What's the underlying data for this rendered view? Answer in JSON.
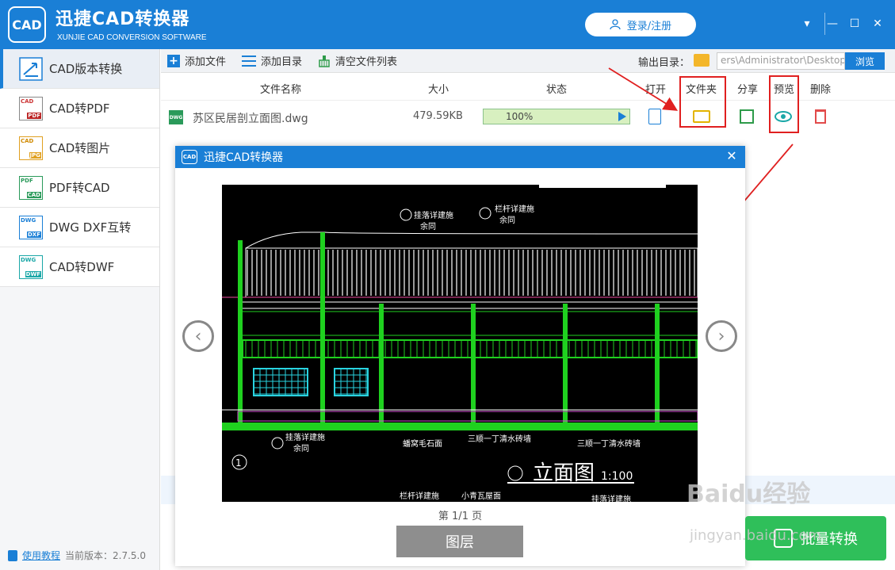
{
  "app": {
    "title": "迅捷CAD转换器",
    "subtitle": "XUNJIE CAD CONVERSION SOFTWARE",
    "logo_text": "CAD",
    "login_label": "登录/注册"
  },
  "window_controls": [
    "▾",
    "—",
    "☐",
    "✕"
  ],
  "sidebar": {
    "items": [
      {
        "label": "CAD版本转换",
        "icon_top": "",
        "icon_bottom": ""
      },
      {
        "label": "CAD转PDF",
        "icon_top": "CAD",
        "icon_bottom": "PDF"
      },
      {
        "label": "CAD转图片",
        "icon_top": "CAD",
        "icon_bottom": "JPG"
      },
      {
        "label": "PDF转CAD",
        "icon_top": "PDF",
        "icon_bottom": "CAD"
      },
      {
        "label": "DWG DXF互转",
        "icon_top": "DWG",
        "icon_bottom": "DXF"
      },
      {
        "label": "CAD转DWF",
        "icon_top": "DWG",
        "icon_bottom": "DWF"
      }
    ],
    "footer_link": "使用教程",
    "footer_version": "当前版本：2.7.5.0"
  },
  "toolbar": {
    "add_file": "添加文件",
    "add_dir": "添加目录",
    "clear_list": "清空文件列表",
    "output_label": "输出目录：",
    "output_path": "ers\\Administrator\\Desktop",
    "browse": "浏览"
  },
  "table": {
    "headers": {
      "name": "文件名称",
      "size": "大小",
      "status": "状态",
      "open": "打开",
      "folder": "文件夹",
      "share": "分享",
      "preview": "预览",
      "delete": "删除"
    },
    "rows": [
      {
        "badge": "DWG",
        "name": "苏区民居剖立面图.dwg",
        "size": "479.59KB",
        "progress_text": "100%",
        "progress": 100
      }
    ]
  },
  "dialog": {
    "title": "迅捷CAD转换器",
    "logo_text": "CAD",
    "close": "✕",
    "prev": "‹",
    "next": "›",
    "page_indicator": "第 1/1 页",
    "layer_button": "图层"
  },
  "drawing": {
    "labels": [
      "挂落详建施",
      "余同",
      "栏杆详建施",
      "余同",
      "挂落详建施",
      "余同",
      "蟠窝毛石面",
      "三顺一丁清水砖墙",
      "三顺一丁清水砖墙",
      "立面图",
      "1:100",
      "栏杆详建施",
      "小青瓦屋面",
      "挂落详建施"
    ],
    "circle_label": "1"
  },
  "batch_button": "批量转换",
  "watermark": {
    "line1": "Baidu经验",
    "line2": "jingyan.baidu.com"
  },
  "colors": {
    "accent": "#1a7fd6",
    "green": "#2fbf5a",
    "annotation_red": "#e02020"
  }
}
